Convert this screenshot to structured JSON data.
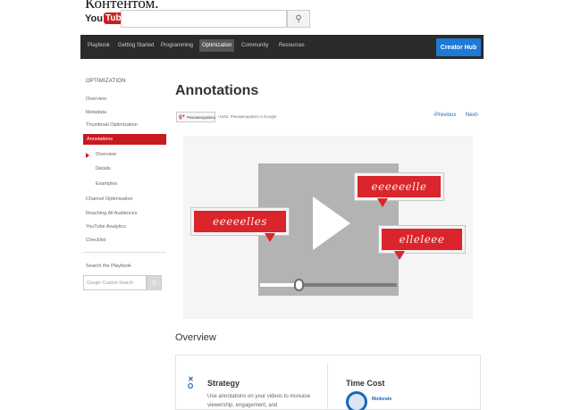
{
  "caption": "Контентом.",
  "header": {
    "logo_you": "You",
    "logo_tube": "Tube",
    "search_icon": "search-icon"
  },
  "nav": {
    "items": [
      "Playbook",
      "Getting Started",
      "Programming",
      "Optimization",
      "Community",
      "Resources"
    ],
    "active": "Optimization",
    "creator_hub": "Creator Hub"
  },
  "sidebar": {
    "title": "OPTIMIZATION",
    "items": [
      "Overview",
      "Metadata",
      "Thumbnail Optimization",
      "Annotations",
      "Overview",
      "Details",
      "Examples",
      "Channel Optimization",
      "Reaching All Audiences",
      "YouTube Analytics",
      "Checklist"
    ],
    "search_label": "Search the Playbook",
    "search_placeholder": "Google Custom Search"
  },
  "main": {
    "title": "Annotations",
    "gplus_label": "Рекомендовать",
    "gplus_recommend": "+1162. Рекомендовать в Google",
    "prev": "‹Previous",
    "next": "Next›"
  },
  "hero": {
    "bubble_left": "eeeeelles",
    "bubble_top": "eeeeeelle",
    "bubble_bottom": "elleleee",
    "progress": 0.28
  },
  "overview": {
    "title": "Overview",
    "strategy_title": "Strategy",
    "strategy_desc": "Use annotations on your videos to increase viewership, engagement, and",
    "timecost_title": "Time Cost",
    "timecost_value": "Moderate"
  },
  "colors": {
    "accent_red": "#c8191f",
    "creator_hub_blue": "#1f7ad6"
  }
}
